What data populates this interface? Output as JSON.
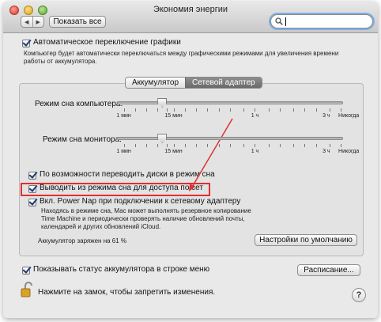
{
  "window": {
    "title": "Экономия энергии"
  },
  "toolbar": {
    "back_label": "◀",
    "forward_label": "▶",
    "show_all_label": "Показать все",
    "search_value": ""
  },
  "auto_switch": {
    "label": "Автоматическое переключение графики",
    "description_line1": "Компьютер будет автоматически переключаться между графическими режимами для увеличения времени",
    "description_line2": "работы от аккумулятора."
  },
  "tabs": [
    {
      "label": "Аккумулятор",
      "selected": false
    },
    {
      "label": "Сетевой адаптер",
      "selected": true
    }
  ],
  "sleep_computer": {
    "label": "Режим сна компьютера:",
    "value_fraction": 0.2,
    "ticks": [
      "1 мин",
      "15 мин",
      "1 ч",
      "3 ч",
      "Никогда"
    ]
  },
  "sleep_display": {
    "label": "Режим сна монитора:",
    "value_fraction": 0.2,
    "ticks": [
      "1 мин",
      "15 мин",
      "1 ч",
      "3 ч",
      "Никогда"
    ]
  },
  "options": {
    "disks_sleep": "По возможности переводить диски в режим сна",
    "wake_network": "Выводить из режима сна для доступа по сет",
    "power_nap": "Вкл. Power Nap при подключении к сетевому адаптеру",
    "power_nap_desc1": "Находясь в режиме сна, Мас может выполнять резервное копирование",
    "power_nap_desc2": "Time Machine и периодически проверять наличие обновлений почты,",
    "power_nap_desc3": "календарей и других обновлений iCloud."
  },
  "battery_status": "Аккумулятор заряжен на 61 %",
  "defaults_button": "Настройки по умолчанию",
  "show_battery_status": "Показывать статус аккумулятора в строке меню",
  "schedule_button": "Расписание...",
  "lock_text": "Нажмите на замок, чтобы запретить изменения.",
  "help_label": "?",
  "colors": {
    "annotation": "#e03030",
    "selected_tab": "#7a7a7a",
    "search_focus": "#7eb0e8"
  }
}
